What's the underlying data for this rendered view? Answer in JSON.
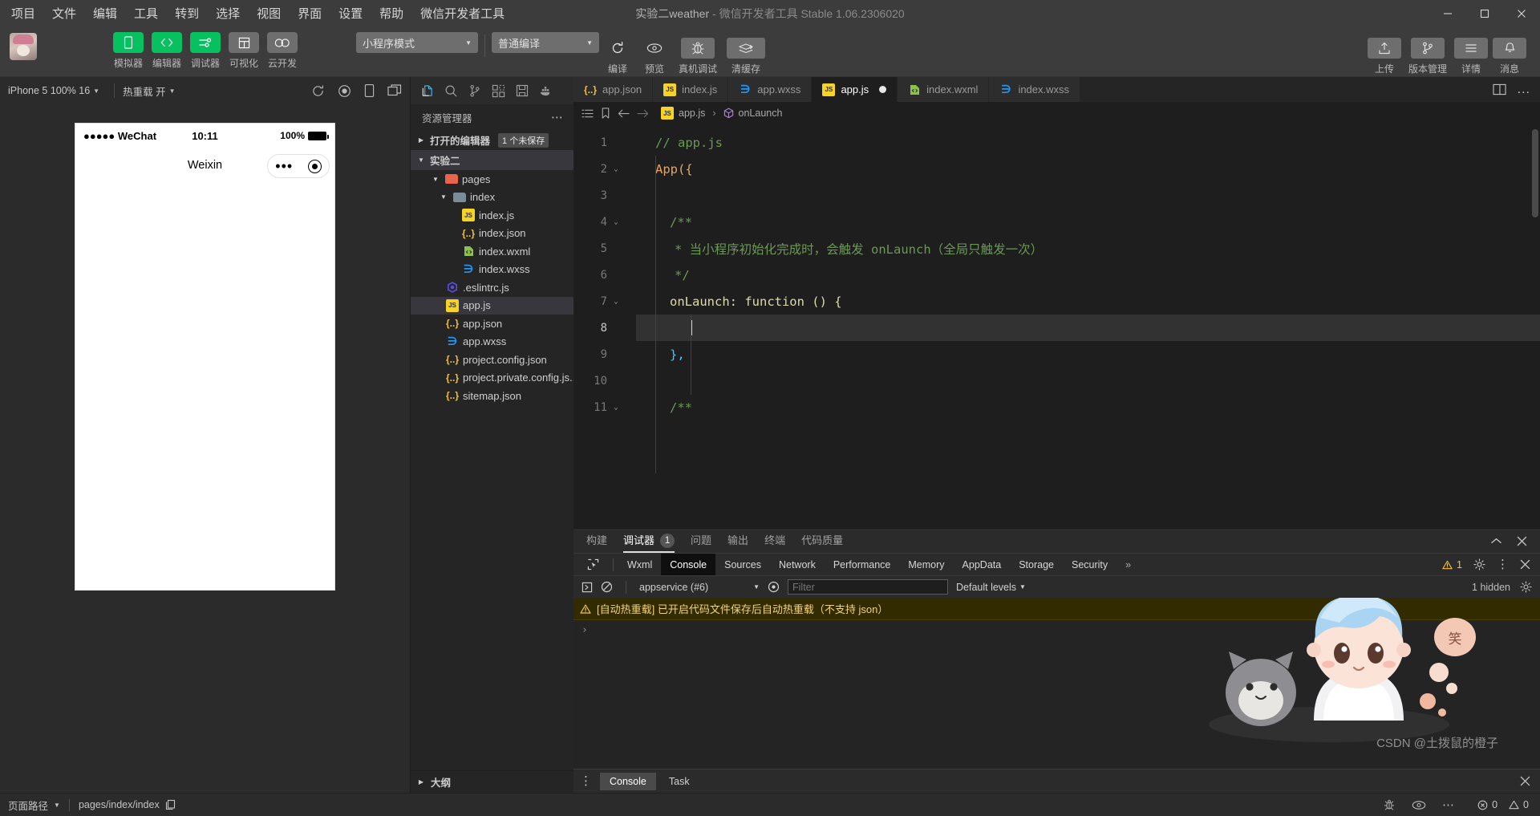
{
  "window": {
    "title_main": "实验二weather",
    "title_dim": " - 微信开发者工具 Stable 1.06.2306020",
    "minimize": "minimize-icon",
    "maximize": "maximize-icon",
    "close": "close-icon"
  },
  "menubar": {
    "items": [
      {
        "label": "项目"
      },
      {
        "label": "文件"
      },
      {
        "label": "编辑"
      },
      {
        "label": "工具"
      },
      {
        "label": "转到"
      },
      {
        "label": "选择"
      },
      {
        "label": "视图"
      },
      {
        "label": "界面"
      },
      {
        "label": "设置"
      },
      {
        "label": "帮助"
      },
      {
        "label": "微信开发者工具"
      }
    ]
  },
  "toolbar": {
    "left_buttons": [
      {
        "label": "模拟器",
        "icon": "phone-icon",
        "style": "green"
      },
      {
        "label": "编辑器",
        "icon": "code-icon",
        "style": "green"
      },
      {
        "label": "调试器",
        "icon": "sliders-icon",
        "style": "green"
      },
      {
        "label": "可视化",
        "icon": "layout-icon",
        "style": "grey"
      },
      {
        "label": "云开发",
        "icon": "cloud-icon",
        "style": "grey"
      }
    ],
    "mode_select": "小程序模式",
    "compile_select": "普通编译",
    "action_buttons": [
      {
        "label": "编译",
        "icon": "refresh-icon",
        "boxed": false
      },
      {
        "label": "预览",
        "icon": "eye-icon",
        "boxed": false
      },
      {
        "label": "真机调试",
        "icon": "bug-icon",
        "boxed": true
      },
      {
        "label": "清缓存",
        "icon": "layers-icon",
        "boxed": true
      }
    ],
    "right_buttons": [
      {
        "label": "上传",
        "icon": "upload-icon"
      },
      {
        "label": "版本管理",
        "icon": "git-branch-icon"
      },
      {
        "label": "详情",
        "icon": "menu-lines-icon"
      },
      {
        "label": "消息",
        "icon": "bell-icon"
      }
    ]
  },
  "simulator": {
    "device": "iPhone 5 100% 16",
    "hotreload": "热重载 开",
    "right_icons": [
      "rotate-icon",
      "record-icon",
      "device-icon",
      "split-icon"
    ],
    "phone": {
      "carrier": "●●●●● WeChat",
      "time": "10:11",
      "battery_pct": "100%",
      "nav_title": "Weixin",
      "capsule_more": "more-dots-icon",
      "capsule_target": "target-icon"
    }
  },
  "explorer": {
    "activity_icons": [
      "files-icon",
      "search-icon",
      "source-control-icon",
      "extensions-icon",
      "save-icon",
      "docker-icon"
    ],
    "title": "资源管理器",
    "more": "more-icon",
    "open_editors": {
      "label": "打开的编辑器",
      "badge": "1 个未保存"
    },
    "project": "实验二",
    "tree": [
      {
        "label": "pages",
        "type": "folder-pages",
        "indent": 2,
        "twisty": "down"
      },
      {
        "label": "index",
        "type": "folder",
        "indent": 3,
        "twisty": "down"
      },
      {
        "label": "index.js",
        "type": "js",
        "indent": 4,
        "twisty": ""
      },
      {
        "label": "index.json",
        "type": "json",
        "indent": 4,
        "twisty": ""
      },
      {
        "label": "index.wxml",
        "type": "wxml",
        "indent": 4,
        "twisty": ""
      },
      {
        "label": "index.wxss",
        "type": "wxss",
        "indent": 4,
        "twisty": ""
      },
      {
        "label": ".eslintrc.js",
        "type": "eslint",
        "indent": 3,
        "twisty": ""
      },
      {
        "label": "app.js",
        "type": "js",
        "indent": 3,
        "twisty": "",
        "selected": true
      },
      {
        "label": "app.json",
        "type": "json",
        "indent": 3,
        "twisty": ""
      },
      {
        "label": "app.wxss",
        "type": "wxss",
        "indent": 3,
        "twisty": ""
      },
      {
        "label": "project.config.json",
        "type": "json",
        "indent": 3,
        "twisty": ""
      },
      {
        "label": "project.private.config.js...",
        "type": "json",
        "indent": 3,
        "twisty": ""
      },
      {
        "label": "sitemap.json",
        "type": "json",
        "indent": 3,
        "twisty": ""
      }
    ],
    "outline": "大纲"
  },
  "editor": {
    "tabs": [
      {
        "label": "app.json",
        "type": "json",
        "active": false,
        "dirty": false
      },
      {
        "label": "index.js",
        "type": "js",
        "active": false,
        "dirty": false
      },
      {
        "label": "app.wxss",
        "type": "wxss",
        "active": false,
        "dirty": false
      },
      {
        "label": "app.js",
        "type": "js",
        "active": true,
        "dirty": true
      },
      {
        "label": "index.wxml",
        "type": "wxml",
        "active": false,
        "dirty": false
      },
      {
        "label": "index.wxss",
        "type": "wxss",
        "active": false,
        "dirty": false
      }
    ],
    "tabs_overflow": "...",
    "breadcrumb": {
      "outline_icon": "list-icon",
      "bookmark_icon": "bookmark-icon",
      "back_icon": "arrow-left-icon",
      "forward_icon": "arrow-right-icon",
      "file": "app.js",
      "separator": "›",
      "symbol": "onLaunch",
      "symbol_icon": "method-icon"
    },
    "lines": [
      {
        "n": "1",
        "fold": "",
        "text": "// app.js",
        "kind": "comment"
      },
      {
        "n": "2",
        "fold": "⌄",
        "text": "App({",
        "kind": "app_open"
      },
      {
        "n": "3",
        "fold": "",
        "text": "",
        "kind": "plain"
      },
      {
        "n": "4",
        "fold": "⌄",
        "text": "/**",
        "kind": "comment"
      },
      {
        "n": "5",
        "fold": "",
        "text": "* 当小程序初始化完成时，会触发 onLaunch（全局只触发一次）",
        "kind": "comment"
      },
      {
        "n": "6",
        "fold": "",
        "text": "*/",
        "kind": "comment"
      },
      {
        "n": "7",
        "fold": "⌄",
        "text": "onLaunch: function () {",
        "kind": "fn"
      },
      {
        "n": "8",
        "fold": "",
        "text": "",
        "kind": "cursor"
      },
      {
        "n": "9",
        "fold": "",
        "text": "},",
        "kind": "close"
      },
      {
        "n": "10",
        "fold": "",
        "text": "",
        "kind": "plain"
      },
      {
        "n": "11",
        "fold": "⌄",
        "text": "/**",
        "kind": "comment"
      }
    ]
  },
  "devtools": {
    "panel_tabs": [
      {
        "label": "构建",
        "badge": "",
        "active": false
      },
      {
        "label": "调试器",
        "badge": "1",
        "active": true
      },
      {
        "label": "问题",
        "badge": "",
        "active": false
      },
      {
        "label": "输出",
        "badge": "",
        "active": false
      },
      {
        "label": "终端",
        "badge": "",
        "active": false
      },
      {
        "label": "代码质量",
        "badge": "",
        "active": false
      }
    ],
    "panel_actions": [
      "collapse-icon",
      "close-icon"
    ],
    "cdt_tabs": [
      {
        "label": "Wxml",
        "active": false
      },
      {
        "label": "Console",
        "active": true
      },
      {
        "label": "Sources",
        "active": false
      },
      {
        "label": "Network",
        "active": false
      },
      {
        "label": "Performance",
        "active": false
      },
      {
        "label": "Memory",
        "active": false
      },
      {
        "label": "AppData",
        "active": false
      },
      {
        "label": "Storage",
        "active": false
      },
      {
        "label": "Security",
        "active": false
      }
    ],
    "cdt_overflow": "»",
    "warning_count": "1",
    "settings_icon": "gear-icon",
    "kebab_icon": "kebab-icon",
    "console": {
      "execute_icon": "run-icon",
      "clear_icon": "clear-icon",
      "context": "appservice (#6)",
      "eye_icon": "eye-icon",
      "filter_placeholder": "Filter",
      "filter_value": "",
      "levels": "Default levels",
      "hidden_count": "1 hidden",
      "settings_icon": "gear-icon",
      "message": "[自动热重载] 已开启代码文件保存后自动热重载（不支持 json）",
      "message_icon": "warning-icon",
      "prompt": "›"
    },
    "footer_tabs": [
      {
        "label": "Console",
        "active": true
      },
      {
        "label": "Task",
        "active": false
      }
    ],
    "footer_kebab": "kebab-icon",
    "footer_close": "close-icon"
  },
  "statusbar": {
    "page_path_label": "页面路径",
    "page_path_value": "pages/index/index",
    "copy_icon": "copy-icon",
    "mid_icons": [
      "bug-icon",
      "eye-icon",
      "more-icon"
    ],
    "errors": "0",
    "warnings": "0",
    "error_icon": "error-circle-icon",
    "warning_icon": "warning-triangle-icon"
  },
  "watermark": {
    "text": "CSDN @土拨鼠的橙子"
  },
  "colors": {
    "accent_green": "#07c160",
    "title_bg": "#3c3c3c",
    "editor_bg": "#1e1e1e",
    "sidebar_bg": "#252526",
    "comment": "#6a9955",
    "warning": "#f2c14e"
  }
}
